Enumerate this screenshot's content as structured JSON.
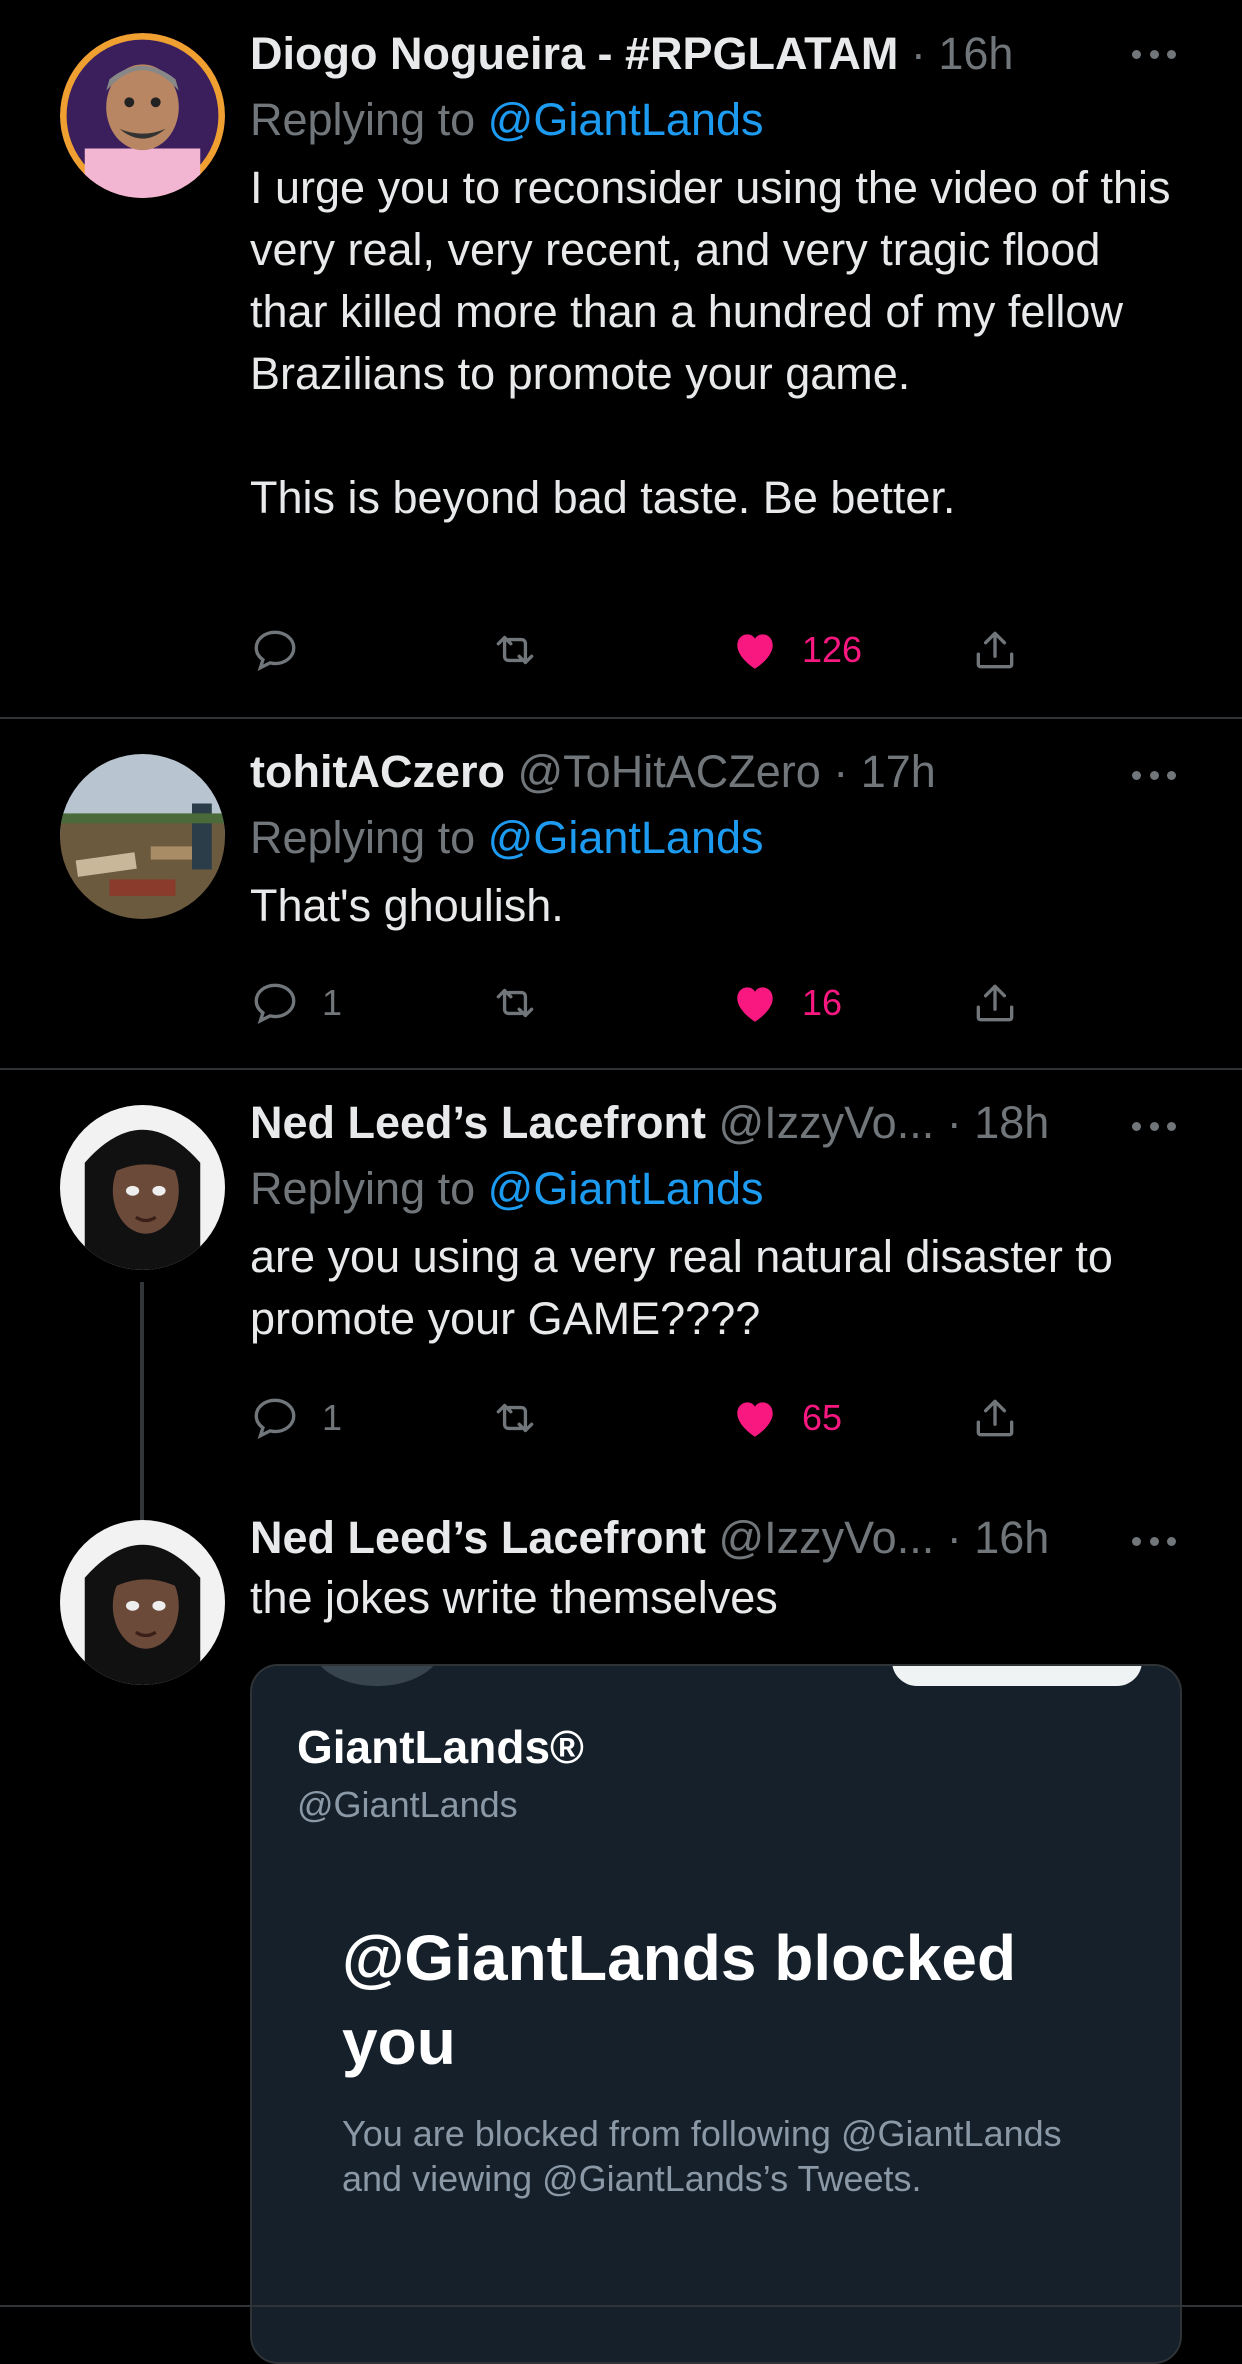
{
  "tweets": [
    {
      "name": "Diogo Nogueira - #RPGLATAM",
      "handle": "",
      "time": "16h",
      "replying_label": "Replying to",
      "replying_to": "@GiantLands",
      "text": "I urge you to reconsider using the video of this very real, very recent, and very tragic flood thar killed more than a hundred of my fellow Brazilians to promote your game.\n\nThis is beyond bad taste. Be better.",
      "replies": "",
      "likes": "126"
    },
    {
      "name": "tohitACzero",
      "handle": "@ToHitACZero",
      "time": "17h",
      "replying_label": "Replying to",
      "replying_to": "@GiantLands",
      "text": "That's ghoulish.",
      "replies": "1",
      "likes": "16"
    },
    {
      "name": "Ned Leed’s Lacefront",
      "handle": "@IzzyVo...",
      "time": "18h",
      "replying_label": "Replying to",
      "replying_to": "@GiantLands",
      "text": "are you using a very real natural disaster to promote your GAME????",
      "replies": "1",
      "likes": "65"
    },
    {
      "name": "Ned Leed’s Lacefront",
      "handle": "@IzzyVo...",
      "time": "16h",
      "text": "the jokes write themselves"
    }
  ],
  "separator": "·",
  "quoted_card": {
    "name": "GiantLands®",
    "handle": "@GiantLands",
    "title": "@GiantLands blocked you",
    "description": "You are blocked from following @GiantLands and viewing @GiantLands’s Tweets."
  },
  "colors": {
    "background": "#000000",
    "like": "#f91880",
    "mention": "#1d9bf0",
    "muted": "#71767b",
    "card_background": "#15202b"
  },
  "icons": [
    "reply-icon",
    "retweet-icon",
    "heart-filled-icon",
    "share-icon",
    "more-icon"
  ]
}
